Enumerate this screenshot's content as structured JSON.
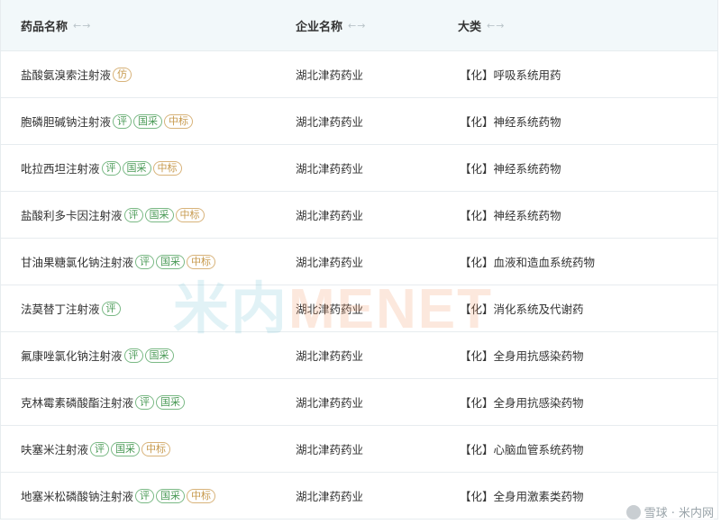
{
  "header": {
    "col1": "药品名称",
    "col2": "企业名称",
    "col3": "大类",
    "sort_arrows": "←→"
  },
  "rows": [
    {
      "name": "盐酸氨溴索注射液",
      "tags": [
        {
          "text": "仿",
          "type": "fang"
        }
      ],
      "company": "湖北津药药业",
      "category": "【化】呼吸系统用药"
    },
    {
      "name": "胞磷胆碱钠注射液",
      "tags": [
        {
          "text": "评",
          "type": "ping"
        },
        {
          "text": "国采",
          "type": "guocai"
        },
        {
          "text": "中标",
          "type": "zhongbiao"
        }
      ],
      "company": "湖北津药药业",
      "category": "【化】神经系统药物"
    },
    {
      "name": "吡拉西坦注射液",
      "tags": [
        {
          "text": "评",
          "type": "ping"
        },
        {
          "text": "国采",
          "type": "guocai"
        },
        {
          "text": "中标",
          "type": "zhongbiao"
        }
      ],
      "company": "湖北津药药业",
      "category": "【化】神经系统药物"
    },
    {
      "name": "盐酸利多卡因注射液",
      "tags": [
        {
          "text": "评",
          "type": "ping"
        },
        {
          "text": "国采",
          "type": "guocai"
        },
        {
          "text": "中标",
          "type": "zhongbiao"
        }
      ],
      "company": "湖北津药药业",
      "category": "【化】神经系统药物"
    },
    {
      "name": "甘油果糖氯化钠注射液",
      "tags": [
        {
          "text": "评",
          "type": "ping"
        },
        {
          "text": "国采",
          "type": "guocai"
        },
        {
          "text": "中标",
          "type": "zhongbiao"
        }
      ],
      "company": "湖北津药药业",
      "category": "【化】血液和造血系统药物"
    },
    {
      "name": "法莫替丁注射液",
      "tags": [
        {
          "text": "评",
          "type": "ping"
        }
      ],
      "company": "湖北津药药业",
      "category": "【化】消化系统及代谢药"
    },
    {
      "name": "氟康唑氯化钠注射液",
      "tags": [
        {
          "text": "评",
          "type": "ping"
        },
        {
          "text": "国采",
          "type": "guocai"
        }
      ],
      "company": "湖北津药药业",
      "category": "【化】全身用抗感染药物"
    },
    {
      "name": "克林霉素磷酸酯注射液",
      "tags": [
        {
          "text": "评",
          "type": "ping"
        },
        {
          "text": "国采",
          "type": "guocai"
        }
      ],
      "company": "湖北津药药业",
      "category": "【化】全身用抗感染药物"
    },
    {
      "name": "呋塞米注射液",
      "tags": [
        {
          "text": "评",
          "type": "ping"
        },
        {
          "text": "国采",
          "type": "guocai"
        },
        {
          "text": "中标",
          "type": "zhongbiao"
        }
      ],
      "company": "湖北津药药业",
      "category": "【化】心脑血管系统药物"
    },
    {
      "name": "地塞米松磷酸钠注射液",
      "tags": [
        {
          "text": "评",
          "type": "ping"
        },
        {
          "text": "国采",
          "type": "guocai"
        },
        {
          "text": "中标",
          "type": "zhongbiao"
        }
      ],
      "company": "湖北津药药业",
      "category": "【化】全身用激素类药物"
    }
  ],
  "watermark": {
    "part1": "米内",
    "part2": "MENET"
  },
  "brand": "雪球 · 米内网",
  "colors": {
    "header_bg": "#f2f8fa",
    "tag_green": "#4a9a56",
    "tag_gold": "#c79a4e",
    "border": "#e7ecef"
  }
}
